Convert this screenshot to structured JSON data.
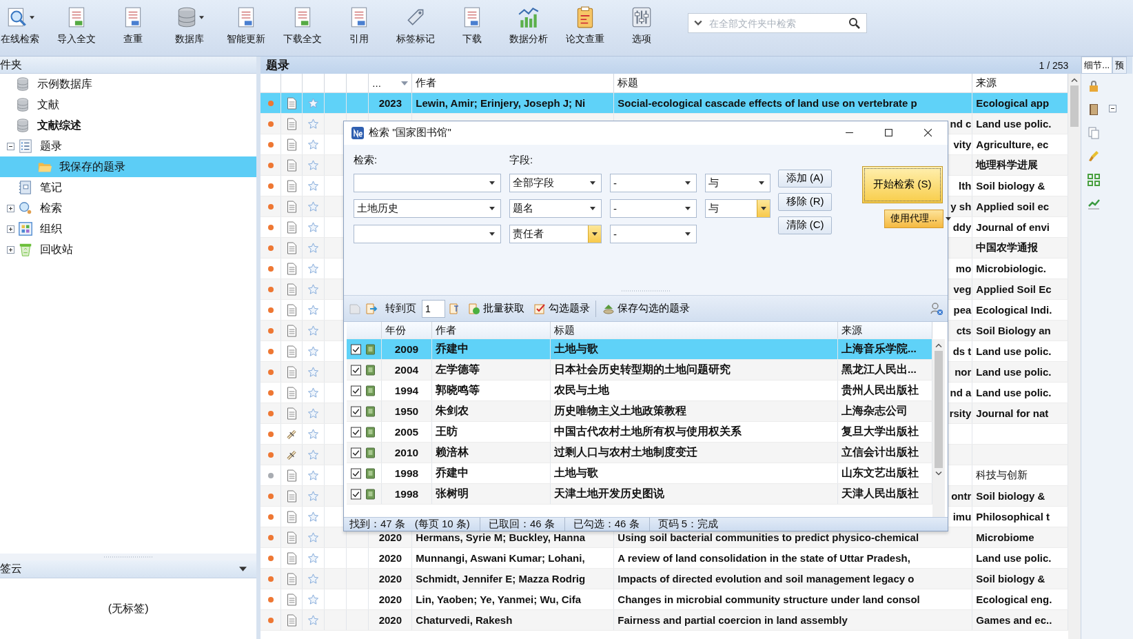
{
  "toolbar": {
    "buttons": [
      {
        "label": "在线检索",
        "dropdown": true
      },
      {
        "label": "导入全文",
        "dropdown": false
      },
      {
        "label": "查重",
        "dropdown": false
      },
      {
        "label": "数据库",
        "dropdown": true
      },
      {
        "label": "智能更新",
        "dropdown": false
      },
      {
        "label": "下载全文",
        "dropdown": false
      },
      {
        "label": "引用",
        "dropdown": false
      },
      {
        "label": "标签标记",
        "dropdown": false
      },
      {
        "label": "下载",
        "dropdown": false
      },
      {
        "label": "数据分析",
        "dropdown": false
      },
      {
        "label": "论文查重",
        "dropdown": false
      },
      {
        "label": "选项",
        "dropdown": false
      }
    ],
    "search": {
      "placeholder": "在全部文件夹中检索"
    }
  },
  "folders": {
    "title": "件夹",
    "tree": [
      {
        "label": "示例数据库",
        "kind": "database",
        "active": false,
        "selected": false
      },
      {
        "label": "文献",
        "kind": "database",
        "active": false,
        "selected": false
      },
      {
        "label": "文献综述",
        "kind": "database",
        "active": true,
        "selected": false,
        "children": [
          {
            "label": "题录",
            "kind": "list",
            "expanded": true,
            "selected": false,
            "children": [
              {
                "label": "我保存的题录",
                "kind": "folder",
                "selected": true
              }
            ]
          },
          {
            "label": "笔记",
            "kind": "notebook",
            "selected": false
          },
          {
            "label": "检索",
            "kind": "search",
            "expanded": false,
            "selected": false
          },
          {
            "label": "组织",
            "kind": "grid",
            "expanded": false,
            "selected": false
          },
          {
            "label": "回收站",
            "kind": "recycle",
            "expanded": false,
            "selected": false
          }
        ]
      }
    ]
  },
  "tag_cloud": {
    "title": "签云",
    "empty_text": "(无标签)"
  },
  "records": {
    "title": "题录",
    "page": "1 / 253",
    "columns": [
      "...",
      "作者",
      "标题",
      "来源"
    ],
    "rows": [
      {
        "unread": true,
        "kind": "document",
        "selected": true,
        "year": "2023",
        "author": "Lewin, Amir; Erinjery, Joseph J; Ni",
        "title": "Social-ecological cascade effects of land use on vertebrate p",
        "source": "Ecological app"
      },
      {
        "unread": true,
        "kind": "document",
        "selected": false,
        "title": "nd c",
        "source": "Land use polic."
      },
      {
        "unread": true,
        "kind": "document",
        "selected": false,
        "title": "vity",
        "source": "Agriculture, ec"
      },
      {
        "unread": true,
        "kind": "document",
        "selected": false,
        "source": "地理科学进展"
      },
      {
        "unread": true,
        "kind": "document",
        "selected": false,
        "title": "lth",
        "source": "Soil biology &"
      },
      {
        "unread": true,
        "kind": "document",
        "selected": false,
        "title": "y sh",
        "source": "Applied soil ec"
      },
      {
        "unread": true,
        "kind": "document",
        "selected": false,
        "title": "ddy",
        "source": "Journal of envi"
      },
      {
        "unread": true,
        "kind": "document",
        "selected": false,
        "source": "中国农学通报"
      },
      {
        "unread": true,
        "kind": "document",
        "selected": false,
        "title": "mo",
        "source": "Microbiologic."
      },
      {
        "unread": true,
        "kind": "document",
        "selected": false,
        "title": "veg",
        "source": "Applied Soil Ec"
      },
      {
        "unread": true,
        "kind": "document",
        "selected": false,
        "title": "pea",
        "source": "Ecological Indi."
      },
      {
        "unread": true,
        "kind": "document",
        "selected": false,
        "title": "cts",
        "source": "Soil Biology an"
      },
      {
        "unread": true,
        "kind": "document",
        "selected": false,
        "title": "ds t",
        "source": "Land use polic."
      },
      {
        "unread": true,
        "kind": "document",
        "selected": false,
        "title": "nor",
        "source": "Land use polic."
      },
      {
        "unread": true,
        "kind": "document",
        "selected": false,
        "title": "nd a",
        "source": "Land use polic."
      },
      {
        "unread": true,
        "kind": "document",
        "selected": false,
        "title": "rsity",
        "source": "Journal for nat"
      },
      {
        "unread": true,
        "kind": "attachment",
        "selected": false
      },
      {
        "unread": true,
        "kind": "attachment",
        "selected": false
      },
      {
        "unread": false,
        "kind": "document",
        "selected": false,
        "source": "科技与创新"
      },
      {
        "unread": true,
        "kind": "document",
        "selected": false,
        "title": "ontr",
        "source": "Soil biology &"
      },
      {
        "unread": true,
        "kind": "document",
        "selected": false,
        "title": "imu",
        "source": "Philosophical t"
      },
      {
        "unread": true,
        "kind": "document",
        "selected": false,
        "year": "2020",
        "author": "Hermans, Syrie M; Buckley, Hanna",
        "title": "Using soil bacterial communities to predict physico-chemical",
        "source": "Microbiome"
      },
      {
        "unread": true,
        "kind": "document",
        "selected": false,
        "year": "2020",
        "author": "Munnangi, Aswani Kumar; Lohani,",
        "title": "A review of land consolidation in the state of Uttar Pradesh,",
        "source": "Land use polic."
      },
      {
        "unread": true,
        "kind": "document",
        "selected": false,
        "year": "2020",
        "author": "Schmidt, Jennifer E; Mazza Rodrig",
        "title": "Impacts of directed evolution and soil management legacy o",
        "source": "Soil biology &"
      },
      {
        "unread": true,
        "kind": "document",
        "selected": false,
        "year": "2020",
        "author": "Lin, Yaoben; Ye, Yanmei; Wu, Cifa",
        "title": "Changes in microbial community structure under land consol",
        "source": "Ecological eng."
      },
      {
        "unread": true,
        "kind": "document",
        "selected": false,
        "year": "2020",
        "author": "Chaturvedi, Rakesh",
        "title": "Fairness and partial coercion in land assembly",
        "source": "Games and ec.."
      }
    ]
  },
  "side_panel": {
    "tabs": [
      {
        "label": "细节...",
        "selected": true
      },
      {
        "label": "预",
        "selected": false
      }
    ]
  },
  "dialog": {
    "title": "检索 \"国家图书馆\"",
    "search_label": "检索:",
    "field_label": "字段:",
    "criteria": [
      {
        "field": "全部字段",
        "operator": "-",
        "conjunction": "与",
        "field_hot": false,
        "conjunction_hot": false
      },
      {
        "query": "土地历史",
        "field": "题名",
        "operator": "-",
        "conjunction": "与",
        "field_hot": false,
        "conjunction_hot": true
      },
      {
        "field": "责任者",
        "operator": "-",
        "field_hot": true
      }
    ],
    "buttons": [
      "添加 (A)",
      "移除 (R)",
      "清除 (C)"
    ],
    "start_button": "开始检索 (S)",
    "proxy_button": "使用代理...",
    "toolbar": {
      "goto_label": "转到页",
      "page_value": "1",
      "actions": [
        "批量获取",
        "勾选题录",
        "保存勾选的题录"
      ]
    },
    "results": {
      "columns": [
        "年份",
        "作者",
        "标题",
        "来源"
      ],
      "rows": [
        {
          "checked": true,
          "selected": true,
          "year": "2009",
          "author": "乔建中",
          "title": "土地与歌",
          "source": "上海音乐学院..."
        },
        {
          "checked": true,
          "selected": false,
          "year": "2004",
          "author": "左学德等",
          "title": "日本社会历史转型期的土地问题研究",
          "source": "黑龙江人民出..."
        },
        {
          "checked": true,
          "selected": false,
          "year": "1994",
          "author": "郭晓鸣等",
          "title": "农民与土地",
          "source": "贵州人民出版社"
        },
        {
          "checked": true,
          "selected": false,
          "year": "1950",
          "author": "朱剑农",
          "title": "历史唯物主义土地政策教程",
          "source": "上海杂志公司"
        },
        {
          "checked": true,
          "selected": false,
          "year": "2005",
          "author": "王昉",
          "title": "中国古代农村土地所有权与使用权关系",
          "source": "复旦大学出版社"
        },
        {
          "checked": true,
          "selected": false,
          "year": "2010",
          "author": "赖涪林",
          "title": "过剩人口与农村土地制度变迁",
          "source": "立信会计出版社"
        },
        {
          "checked": true,
          "selected": false,
          "year": "1998",
          "author": "乔建中",
          "title": "土地与歌",
          "source": "山东文艺出版社"
        },
        {
          "checked": true,
          "selected": false,
          "year": "1998",
          "author": "张树明",
          "title": "天津土地开发历史图说",
          "source": "天津人民出版社"
        }
      ]
    },
    "status": [
      "找到：47 条",
      "(每页 10 条)",
      "已取回：46 条",
      "已勾选：46 条",
      "页码 5：完成"
    ]
  }
}
